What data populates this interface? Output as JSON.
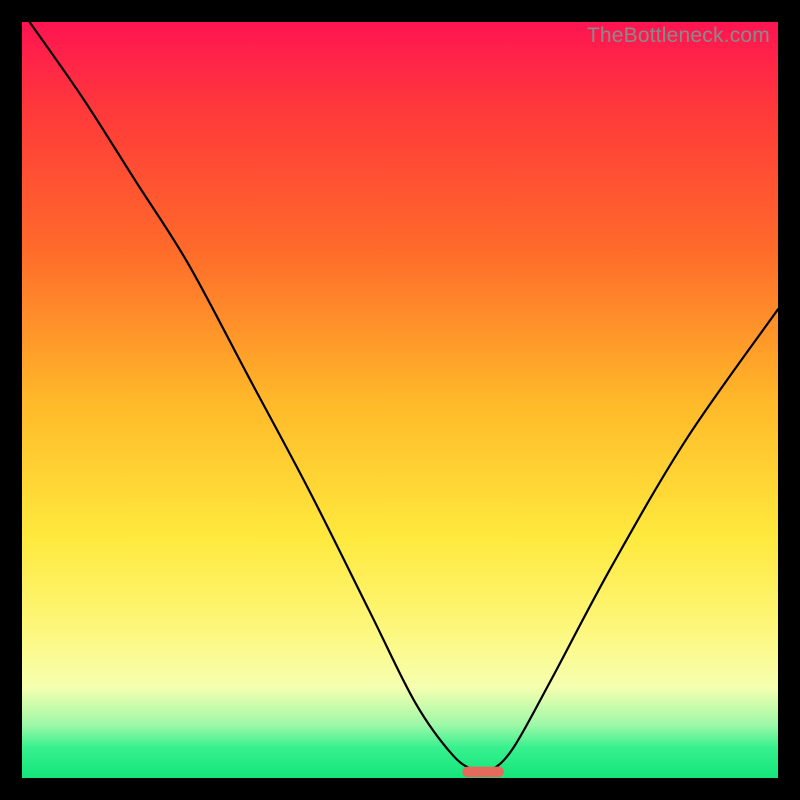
{
  "attribution": "TheBottleneck.com",
  "chart_data": {
    "type": "line",
    "title": "",
    "xlabel": "",
    "ylabel": "",
    "xlim": [
      0,
      100
    ],
    "ylim": [
      0,
      100
    ],
    "series": [
      {
        "name": "curve",
        "x": [
          1,
          8,
          15,
          22,
          30,
          38,
          46,
          52,
          57,
          60,
          62,
          65,
          70,
          78,
          88,
          100
        ],
        "values": [
          100,
          90,
          79,
          68,
          53,
          38,
          22,
          10,
          3,
          1,
          1,
          4,
          13,
          28,
          45,
          62
        ]
      }
    ],
    "minimum_marker": {
      "x": 61.0,
      "y": 0.8,
      "width": 5.5,
      "height": 1.4
    },
    "gradient_stops": [
      {
        "pos": 0,
        "color": "#ff1452"
      },
      {
        "pos": 12,
        "color": "#ff3a3a"
      },
      {
        "pos": 30,
        "color": "#ff6a2a"
      },
      {
        "pos": 50,
        "color": "#ffb829"
      },
      {
        "pos": 68,
        "color": "#ffe93d"
      },
      {
        "pos": 80,
        "color": "#fdf77a"
      },
      {
        "pos": 88,
        "color": "#f6ffb0"
      },
      {
        "pos": 93,
        "color": "#9cf8a8"
      },
      {
        "pos": 96,
        "color": "#37f18e"
      },
      {
        "pos": 100,
        "color": "#14e57b"
      }
    ]
  }
}
